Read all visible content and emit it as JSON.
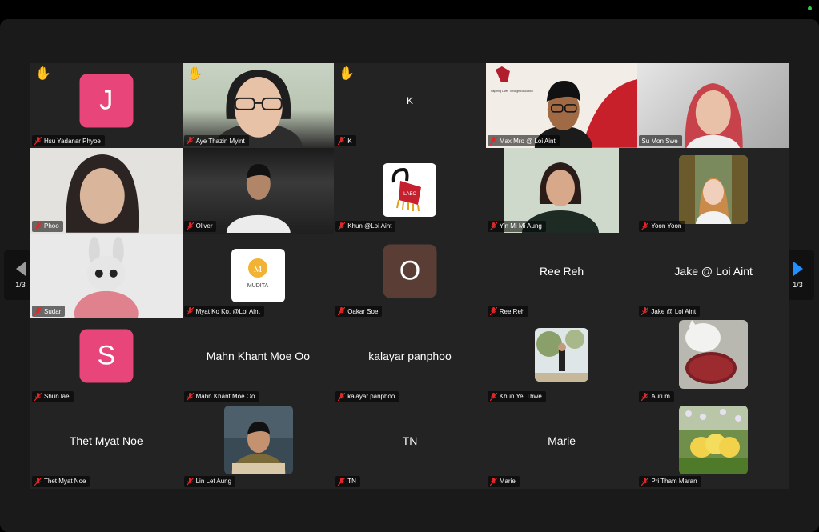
{
  "pagination": {
    "left": "1/3",
    "right": "1/3"
  },
  "participants": [
    {
      "name": "Hsu Yadanar Phyoe",
      "avatar_letter": "J",
      "hand_raised": true
    },
    {
      "name": "Aye Thazin Myint",
      "hand_raised": true
    },
    {
      "name": "K",
      "display_text": "K",
      "hand_raised": true
    },
    {
      "name": "Max Mro @ Loi Aint",
      "slide_caption": "Inspiring Lives Through Education"
    },
    {
      "name": "Su Mon Swe",
      "speaking": true
    },
    {
      "name": "Phoo"
    },
    {
      "name": "Oliver"
    },
    {
      "name": "Khun @Loi Aint",
      "logo_text": "LAEC"
    },
    {
      "name": "Yin Mi Mi Aung"
    },
    {
      "name": "Yoon Yoon"
    },
    {
      "name": "Sudar"
    },
    {
      "name": "Myat Ko Ko, @Loi Aint",
      "logo_text": "MUDITA"
    },
    {
      "name": "Oakar Soe",
      "avatar_letter": "O"
    },
    {
      "name": "Ree Reh",
      "display_text": "Ree Reh"
    },
    {
      "name": "Jake @ Loi Aint",
      "display_text": "Jake @ Loi Aint"
    },
    {
      "name": "Shun lae",
      "avatar_letter": "S"
    },
    {
      "name": "Mahn Khant Moe Oo",
      "display_text": "Mahn Khant Moe Oo"
    },
    {
      "name": "kalayar panphoo",
      "display_text": "kalayar panphoo"
    },
    {
      "name": "Khun Ye' Thwe"
    },
    {
      "name": "Aurum"
    },
    {
      "name": "Thet Myat Noe",
      "display_text": "Thet Myat Noe"
    },
    {
      "name": "Lin Let Aung"
    },
    {
      "name": "TN",
      "display_text": "TN"
    },
    {
      "name": "Marie",
      "display_text": "Marie"
    },
    {
      "name": "Pri Tham Maran"
    }
  ],
  "colors": {
    "avatar_pink": "#e8457a",
    "avatar_brown": "#5a3e36",
    "speaking_border": "#3fb950",
    "muted_mic": "#e02828",
    "nav_arrow": "#1e90ff"
  },
  "icons": {
    "raised_hand": "raised-hand-icon",
    "muted_mic": "microphone-muted-icon",
    "prev": "chevron-left-icon",
    "next": "chevron-right-icon"
  }
}
